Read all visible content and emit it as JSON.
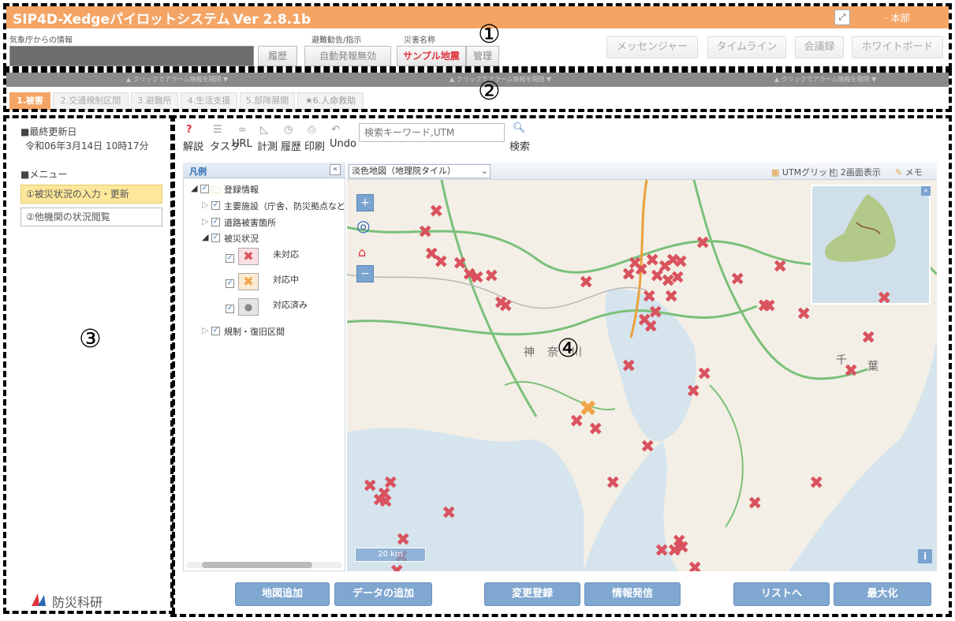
{
  "header": {
    "title": "SIP4D-Xedgeパイロットシステム",
    "version": "Ver 2.8.1b",
    "hq": "· 本部",
    "jma_label": "気象庁からの情報",
    "history_btn": "履歴",
    "evac_label": "避難勧告/指示",
    "evac_btn": "自動発報無効",
    "disaster_label": "災害名称",
    "disaster_name": "サンプル地震",
    "manage_btn": "管理",
    "right_buttons": [
      "メッセンジャー",
      "タイムライン",
      "会議録",
      "ホワイトボード"
    ]
  },
  "alarm": {
    "text": "▲ クリックでアラーム情報を開閉 ▼"
  },
  "tabs": [
    "1.被害",
    "2.交通規制区間",
    "3.避難所",
    "4.生活支援",
    "5.部隊展開",
    "★6.人命救助"
  ],
  "annotations": [
    "①",
    "②",
    "③",
    "④"
  ],
  "left": {
    "updated_label": "■最終更新日",
    "updated_value": "令和06年3月14日 10時17分",
    "menu_label": "■メニュー",
    "menu_items": [
      "①被災状況の入力・更新",
      "②他機関の状況閲覧"
    ],
    "logo_text": "防災科研"
  },
  "toolbar": {
    "items": [
      "解説",
      "タスク",
      "URL",
      "計測",
      "履歴",
      "印刷",
      "Undo"
    ],
    "search_placeholder": "検索キーワード,UTM",
    "search_label": "検索"
  },
  "legend": {
    "title": "凡例",
    "root": "登録情報",
    "items": [
      "主要施設（庁舎、防災拠点など",
      "道路被害箇所",
      "被災状況"
    ],
    "status": [
      "未対応",
      "対応中",
      "対応済み"
    ],
    "last": "規制・復旧区間"
  },
  "map": {
    "layer_select": "淡色地図（地理院タイル）",
    "utm_grid": "UTMグリッド",
    "two_screen": "2画面表示",
    "memo": "メモ",
    "scale": "20 km",
    "place_labels": [
      "神",
      "奈",
      "川",
      "千",
      "葉"
    ]
  },
  "bottom_buttons": [
    "地図追加",
    "データの追加",
    "変更登録",
    "情報発信",
    "リストへ",
    "最大化"
  ],
  "colors": {
    "title_bar": "#f4a566",
    "accent_button": "#7fa7d0",
    "marker_unhandled": "#d9525e",
    "marker_inprogress": "#f0a54a"
  }
}
